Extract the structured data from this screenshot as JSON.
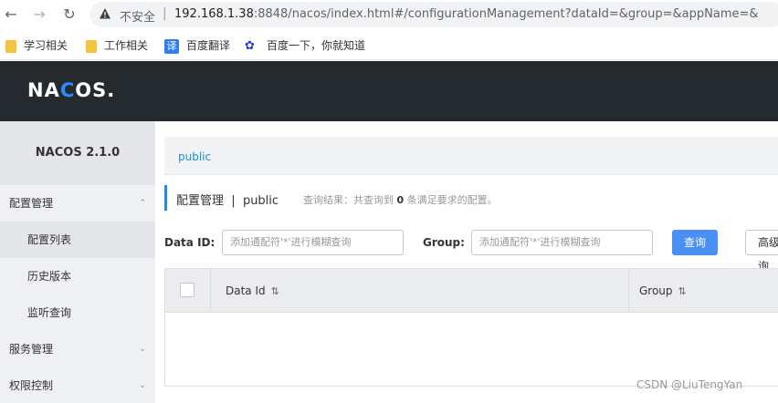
{
  "browser": {
    "insecure_label": "不安全",
    "url_host": "192.168.1.38",
    "url_rest": ":8848/nacos/index.html#/configurationManagement?dataId=&group=&appName=&"
  },
  "bookmarks": [
    {
      "label": "学习相关",
      "icon": "folder-icon"
    },
    {
      "label": "工作相关",
      "icon": "folder-icon"
    },
    {
      "label": "百度翻译",
      "icon": "baidu-fanyi-icon"
    },
    {
      "label": "百度一下，你就知道",
      "icon": "baidu-paw-icon"
    }
  ],
  "header": {
    "logo_part1": "NA",
    "logo_part2": "C",
    "logo_part3": "OS."
  },
  "sidebar": {
    "version": "NACOS 2.1.0",
    "groups": [
      {
        "label": "配置管理",
        "expanded": true
      },
      {
        "label": "服务管理",
        "expanded": false
      },
      {
        "label": "权限控制",
        "expanded": false
      }
    ],
    "items": [
      "配置列表",
      "历史版本",
      "监听查询"
    ]
  },
  "main": {
    "namespace": "public",
    "title": "配置管理",
    "title_sep": "|",
    "title_ns": "public",
    "result_prefix": "查询结果：共查询到",
    "result_count": "0",
    "result_suffix": "条满足要求的配置。",
    "search": {
      "dataid_label": "Data ID:",
      "dataid_placeholder": "添加通配符'*'进行模糊查询",
      "group_label": "Group:",
      "group_placeholder": "添加通配符'*'进行模糊查询",
      "query_button": "查询",
      "advanced_button": "高级查询"
    },
    "table": {
      "columns": [
        "Data Id",
        "Group"
      ],
      "sort_icon": "sort-icon"
    }
  },
  "watermark": "CSDN @LiuTengYan",
  "colors": {
    "header_bg": "#252a2f",
    "accent": "#1e90d0",
    "primary_button": "#4a90f2"
  }
}
